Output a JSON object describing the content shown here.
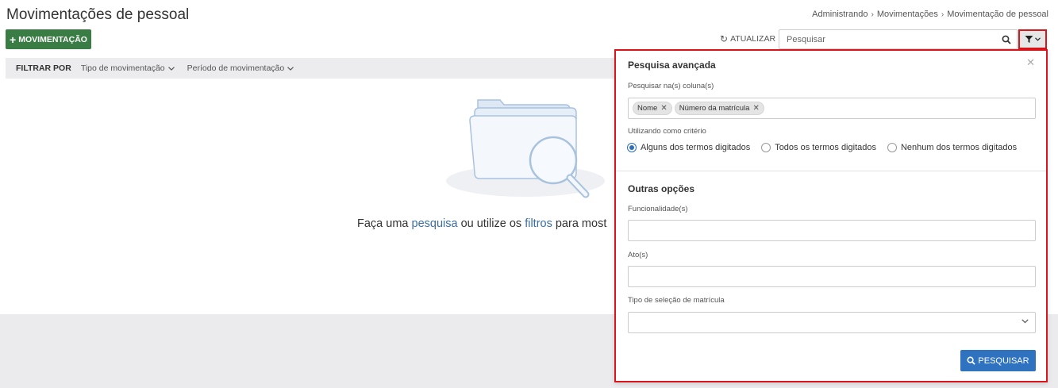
{
  "header": {
    "title": "Movimentações de pessoal",
    "breadcrumb": [
      "Administrando",
      "Movimentações",
      "Movimentação de pessoal"
    ]
  },
  "toolbar": {
    "new_button_label": "MOVIMENTAÇÃO",
    "refresh_label": "ATUALIZAR",
    "search_placeholder": "Pesquisar"
  },
  "filter_bar": {
    "label": "FILTRAR POR",
    "dropdowns": [
      "Tipo de movimentação",
      "Período de movimentação"
    ]
  },
  "empty_state": {
    "text_before": "Faça uma ",
    "link_search": "pesquisa",
    "text_middle": " ou utilize os ",
    "link_filters": "filtros",
    "text_after": " para most"
  },
  "advanced_search": {
    "title": "Pesquisa avançada",
    "columns_label": "Pesquisar na(s) coluna(s)",
    "column_tags": [
      "Nome",
      "Número da matrícula"
    ],
    "criteria_label": "Utilizando como critério",
    "criteria_options": [
      "Alguns dos termos digitados",
      "Todos os termos digitados",
      "Nenhum dos termos digitados"
    ],
    "selected_criteria": "Alguns dos termos digitados",
    "other_options_title": "Outras opções",
    "functionality_label": "Funcionalidade(s)",
    "functionality_value": "",
    "act_label": "Ato(s)",
    "act_value": "",
    "registration_type_label": "Tipo de seleção de matrícula",
    "registration_type_value": "",
    "search_button_label": "PESQUISAR"
  },
  "colors": {
    "primary_green": "#3a7d44",
    "primary_blue": "#2f72c0",
    "highlight_red": "#d9141b",
    "link_blue": "#3a6ea5"
  }
}
